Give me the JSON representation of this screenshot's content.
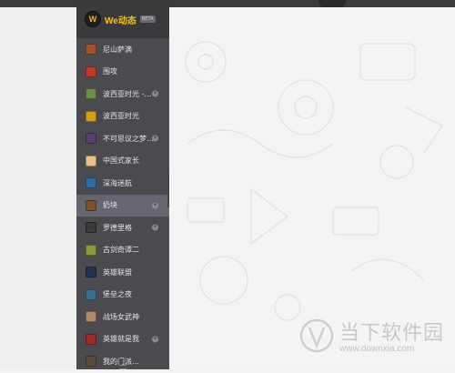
{
  "header": {
    "logo_letter": "W",
    "brand": "We动态",
    "beta": "BETA"
  },
  "games": [
    {
      "label": "尼山萨满",
      "color": "#a0522d",
      "badge": false,
      "selected": false
    },
    {
      "label": "围攻",
      "color": "#c0392b",
      "badge": false,
      "selected": false
    },
    {
      "label": "波西亚时光 -…",
      "color": "#6b8e4e",
      "badge": true,
      "selected": false
    },
    {
      "label": "波西亚时光",
      "color": "#d4a017",
      "badge": false,
      "selected": false
    },
    {
      "label": "不可思议之梦…",
      "color": "#5a3e6b",
      "badge": true,
      "selected": false
    },
    {
      "label": "中国式家长",
      "color": "#e8c28a",
      "badge": false,
      "selected": false
    },
    {
      "label": "深海迷航",
      "color": "#2e6da4",
      "badge": false,
      "selected": false
    },
    {
      "label": "奶块",
      "color": "#7a5230",
      "badge": true,
      "selected": true
    },
    {
      "label": "罗德里格",
      "color": "#3a3a3a",
      "badge": true,
      "selected": false
    },
    {
      "label": "古剑奇谭二",
      "color": "#8a9a3c",
      "badge": false,
      "selected": false
    },
    {
      "label": "英雄联盟",
      "color": "#1f3550",
      "badge": false,
      "selected": false
    },
    {
      "label": "堡垒之夜",
      "color": "#3d6e8f",
      "badge": false,
      "selected": false
    },
    {
      "label": "战场女武神",
      "color": "#b08a6a",
      "badge": false,
      "selected": false
    },
    {
      "label": "英雄就是我",
      "color": "#9c2a2a",
      "badge": true,
      "selected": false
    },
    {
      "label": "我的门派…",
      "color": "#5c4a3a",
      "badge": false,
      "selected": false
    }
  ],
  "watermark": {
    "title": "当下软件园",
    "url": "www.downxia.com"
  }
}
